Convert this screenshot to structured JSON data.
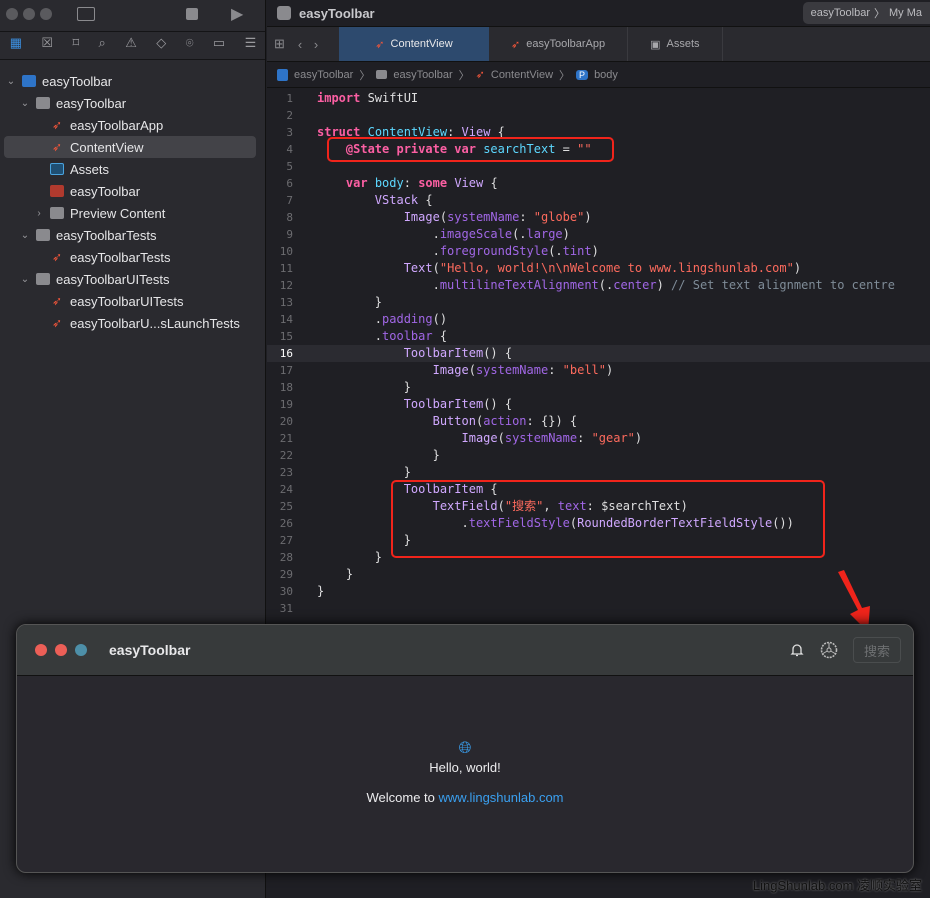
{
  "sidebar": {
    "toolbar_icons": [
      "folder-icon",
      "x-square-icon",
      "bookmark-icon",
      "search-icon",
      "warning-icon",
      "diamond-icon",
      "spray-icon",
      "tag-icon",
      "list-icon"
    ],
    "items": [
      {
        "label": "easyToolbar",
        "indent": 0,
        "icon": "proj",
        "chev": "⌄"
      },
      {
        "label": "easyToolbar",
        "indent": 1,
        "icon": "folder",
        "chev": "⌄"
      },
      {
        "label": "easyToolbarApp",
        "indent": 2,
        "icon": "swift",
        "chev": ""
      },
      {
        "label": "ContentView",
        "indent": 2,
        "icon": "swift",
        "chev": "",
        "selected": true
      },
      {
        "label": "Assets",
        "indent": 2,
        "icon": "assets",
        "chev": ""
      },
      {
        "label": "easyToolbar",
        "indent": 2,
        "icon": "app",
        "chev": ""
      },
      {
        "label": "Preview Content",
        "indent": 2,
        "icon": "folder",
        "chev": "›"
      },
      {
        "label": "easyToolbarTests",
        "indent": 1,
        "icon": "folder",
        "chev": "⌄"
      },
      {
        "label": "easyToolbarTests",
        "indent": 2,
        "icon": "swift",
        "chev": ""
      },
      {
        "label": "easyToolbarUITests",
        "indent": 1,
        "icon": "folder",
        "chev": "⌄"
      },
      {
        "label": "easyToolbarUITests",
        "indent": 2,
        "icon": "swift",
        "chev": ""
      },
      {
        "label": "easyToolbarU...sLaunchTests",
        "indent": 2,
        "icon": "swift",
        "chev": ""
      }
    ]
  },
  "window": {
    "title": "easyToolbar",
    "scheme": "easyToolbar",
    "destination": "My Ma"
  },
  "tabs": [
    {
      "label": "ContentView",
      "active": true
    },
    {
      "label": "easyToolbarApp"
    },
    {
      "label": "Assets"
    }
  ],
  "breadcrumb": [
    "easyToolbar",
    "easyToolbar",
    "ContentView",
    "body"
  ],
  "code": [
    [
      [
        "kw",
        "import"
      ],
      [
        "pl",
        " SwiftUI"
      ]
    ],
    [],
    [
      [
        "kw",
        "struct"
      ],
      [
        "pl",
        " "
      ],
      [
        "decl",
        "ContentView"
      ],
      [
        "pl",
        ": "
      ],
      [
        "ty",
        "View"
      ],
      [
        "pl",
        " {"
      ]
    ],
    [
      [
        "pl",
        "    "
      ],
      [
        "kw",
        "@State private var"
      ],
      [
        "pl",
        " "
      ],
      [
        "decl",
        "searchText"
      ],
      [
        "pl",
        " = "
      ],
      [
        "str",
        "\"\""
      ]
    ],
    [],
    [
      [
        "pl",
        "    "
      ],
      [
        "kw",
        "var"
      ],
      [
        "pl",
        " "
      ],
      [
        "decl",
        "body"
      ],
      [
        "pl",
        ": "
      ],
      [
        "kw",
        "some"
      ],
      [
        "pl",
        " "
      ],
      [
        "ty",
        "View"
      ],
      [
        "pl",
        " {"
      ]
    ],
    [
      [
        "pl",
        "        "
      ],
      [
        "ty",
        "VStack"
      ],
      [
        "pl",
        " {"
      ]
    ],
    [
      [
        "pl",
        "            "
      ],
      [
        "ty",
        "Image"
      ],
      [
        "pl",
        "("
      ],
      [
        "mem",
        "systemName"
      ],
      [
        "pl",
        ": "
      ],
      [
        "str",
        "\"globe\""
      ],
      [
        "pl",
        ")"
      ]
    ],
    [
      [
        "pl",
        "                ."
      ],
      [
        "mem",
        "imageScale"
      ],
      [
        "pl",
        "(."
      ],
      [
        "mem",
        "large"
      ],
      [
        "pl",
        ")"
      ]
    ],
    [
      [
        "pl",
        "                ."
      ],
      [
        "mem",
        "foregroundStyle"
      ],
      [
        "pl",
        "(."
      ],
      [
        "mem",
        "tint"
      ],
      [
        "pl",
        ")"
      ]
    ],
    [
      [
        "pl",
        "            "
      ],
      [
        "ty",
        "Text"
      ],
      [
        "pl",
        "("
      ],
      [
        "str",
        "\"Hello, world!\\n\\nWelcome to www.lingshunlab.com\""
      ],
      [
        "pl",
        ")"
      ]
    ],
    [
      [
        "pl",
        "                ."
      ],
      [
        "mem",
        "multilineTextAlignment"
      ],
      [
        "pl",
        "(."
      ],
      [
        "mem",
        "center"
      ],
      [
        "pl",
        ") "
      ],
      [
        "cm",
        "// Set text alignment to centre"
      ]
    ],
    [
      [
        "pl",
        "        }"
      ]
    ],
    [
      [
        "pl",
        "        ."
      ],
      [
        "mem",
        "padding"
      ],
      [
        "pl",
        "()"
      ]
    ],
    [
      [
        "pl",
        "        ."
      ],
      [
        "mem",
        "toolbar"
      ],
      [
        "pl",
        " {"
      ]
    ],
    [
      [
        "pl",
        "            "
      ],
      [
        "ty",
        "ToolbarItem"
      ],
      [
        "pl",
        "() {"
      ]
    ],
    [
      [
        "pl",
        "                "
      ],
      [
        "ty",
        "Image"
      ],
      [
        "pl",
        "("
      ],
      [
        "mem",
        "systemName"
      ],
      [
        "pl",
        ": "
      ],
      [
        "str",
        "\"bell\""
      ],
      [
        "pl",
        ")"
      ]
    ],
    [
      [
        "pl",
        "            }"
      ]
    ],
    [
      [
        "pl",
        "            "
      ],
      [
        "ty",
        "ToolbarItem"
      ],
      [
        "pl",
        "() {"
      ]
    ],
    [
      [
        "pl",
        "                "
      ],
      [
        "ty",
        "Button"
      ],
      [
        "pl",
        "("
      ],
      [
        "mem",
        "action"
      ],
      [
        "pl",
        ": {}) {"
      ]
    ],
    [
      [
        "pl",
        "                    "
      ],
      [
        "ty",
        "Image"
      ],
      [
        "pl",
        "("
      ],
      [
        "mem",
        "systemName"
      ],
      [
        "pl",
        ": "
      ],
      [
        "str",
        "\"gear\""
      ],
      [
        "pl",
        ")"
      ]
    ],
    [
      [
        "pl",
        "                }"
      ]
    ],
    [
      [
        "pl",
        "            }"
      ]
    ],
    [
      [
        "pl",
        "            "
      ],
      [
        "ty",
        "ToolbarItem"
      ],
      [
        "pl",
        " {"
      ]
    ],
    [
      [
        "pl",
        "                "
      ],
      [
        "ty",
        "TextField"
      ],
      [
        "pl",
        "("
      ],
      [
        "str",
        "\"搜索\""
      ],
      [
        "pl",
        ", "
      ],
      [
        "mem",
        "text"
      ],
      [
        "pl",
        ": $searchText)"
      ]
    ],
    [
      [
        "pl",
        "                    ."
      ],
      [
        "mem",
        "textFieldStyle"
      ],
      [
        "pl",
        "("
      ],
      [
        "ty",
        "RoundedBorderTextFieldStyle"
      ],
      [
        "pl",
        "())"
      ]
    ],
    [
      [
        "pl",
        "            }"
      ]
    ],
    [
      [
        "pl",
        "        }"
      ]
    ],
    [
      [
        "pl",
        "    }"
      ]
    ],
    [
      [
        "pl",
        "}"
      ]
    ],
    []
  ],
  "current_line": 16,
  "preview": {
    "title": "easyToolbar",
    "search_placeholder": "搜索",
    "hello": "Hello, world!",
    "welcome_prefix": "Welcome to ",
    "link": "www.lingshunlab.com"
  },
  "watermark": "LingShunlab.com 凌顺实验室",
  "colors": {
    "accent": "#3aa0f0",
    "highlight": "#f0241b"
  }
}
